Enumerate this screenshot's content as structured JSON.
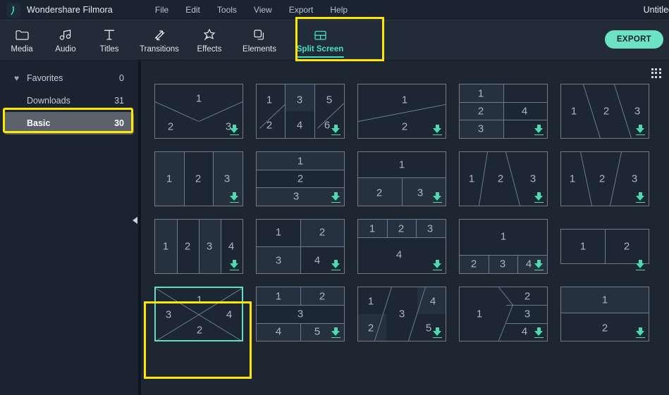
{
  "window": {
    "app_name": "Wondershare Filmora",
    "document_title": "Untitled",
    "logo_icon": "filmora-logo-icon"
  },
  "menubar": {
    "items": [
      {
        "label": "File"
      },
      {
        "label": "Edit"
      },
      {
        "label": "Tools"
      },
      {
        "label": "View"
      },
      {
        "label": "Export"
      },
      {
        "label": "Help"
      }
    ]
  },
  "toolbar": {
    "items": [
      {
        "label": "Media",
        "icon": "folder-icon",
        "active": false
      },
      {
        "label": "Audio",
        "icon": "music-note-icon",
        "active": false
      },
      {
        "label": "Titles",
        "icon": "text-t-icon",
        "active": false
      },
      {
        "label": "Transitions",
        "icon": "diagonal-arrows-icon",
        "active": false
      },
      {
        "label": "Effects",
        "icon": "sparkle-star-icon",
        "active": false
      },
      {
        "label": "Elements",
        "icon": "overlapping-squares-icon",
        "active": false
      },
      {
        "label": "Split Screen",
        "icon": "split-screen-icon",
        "active": true
      }
    ],
    "export_label": "EXPORT"
  },
  "sidebar": {
    "items": [
      {
        "label": "Favorites",
        "count": "0",
        "icon": "heart-icon",
        "selected": false,
        "indent": false
      },
      {
        "label": "Downloads",
        "count": "31",
        "icon": "",
        "selected": false,
        "indent": true
      },
      {
        "label": "Basic",
        "count": "30",
        "icon": "",
        "selected": true,
        "indent": true
      }
    ],
    "collapse_icon": "collapse-left-arrow-icon"
  },
  "content": {
    "grid_view_icon": "grid-dots-icon",
    "download_icon": "download-arrow-icon",
    "templates": [
      {
        "id": "t1",
        "layout": "v-split-3",
        "numbers": [
          "1",
          "2",
          "3"
        ],
        "downloadable": true,
        "selected": false
      },
      {
        "id": "t2",
        "layout": "six-diag",
        "numbers": [
          "1",
          "3",
          "5",
          "2",
          "4",
          "6"
        ],
        "downloadable": true,
        "selected": false
      },
      {
        "id": "t3",
        "layout": "diag-2",
        "numbers": [
          "1",
          "2"
        ],
        "downloadable": true,
        "selected": false
      },
      {
        "id": "t4",
        "layout": "stack3-right1",
        "numbers": [
          "1",
          "2",
          "3",
          "4"
        ],
        "downloadable": true,
        "selected": false
      },
      {
        "id": "t5",
        "layout": "slant-3-right",
        "numbers": [
          "1",
          "2",
          "3"
        ],
        "downloadable": true,
        "selected": false
      },
      {
        "id": "t6",
        "layout": "cols-3",
        "numbers": [
          "1",
          "2",
          "3"
        ],
        "downloadable": true,
        "selected": false
      },
      {
        "id": "t7",
        "layout": "rows-3",
        "numbers": [
          "1",
          "2",
          "3"
        ],
        "downloadable": true,
        "selected": false
      },
      {
        "id": "t8",
        "layout": "top1-bottom2",
        "numbers": [
          "1",
          "2",
          "3"
        ],
        "downloadable": true,
        "selected": false
      },
      {
        "id": "t9",
        "layout": "slant-3-a",
        "numbers": [
          "1",
          "2",
          "3"
        ],
        "downloadable": true,
        "selected": false
      },
      {
        "id": "t10",
        "layout": "slant-3-v",
        "numbers": [
          "1",
          "2",
          "3"
        ],
        "downloadable": true,
        "selected": false
      },
      {
        "id": "t11",
        "layout": "cols-4",
        "numbers": [
          "1",
          "2",
          "3",
          "4"
        ],
        "downloadable": true,
        "selected": false
      },
      {
        "id": "t12",
        "layout": "grid-2x2",
        "numbers": [
          "1",
          "2",
          "3",
          "4"
        ],
        "downloadable": true,
        "selected": false
      },
      {
        "id": "t13",
        "layout": "top3-bottom1",
        "numbers": [
          "1",
          "2",
          "3",
          "4"
        ],
        "downloadable": true,
        "selected": false
      },
      {
        "id": "t14",
        "layout": "top1-bottom3",
        "numbers": [
          "1",
          "2",
          "3",
          "4"
        ],
        "downloadable": true,
        "selected": false
      },
      {
        "id": "t15",
        "layout": "letterbox-2",
        "numbers": [
          "1",
          "2"
        ],
        "downloadable": true,
        "selected": false
      },
      {
        "id": "t16",
        "layout": "x-cross-4",
        "numbers": [
          "1",
          "3",
          "4",
          "2"
        ],
        "downloadable": false,
        "selected": true
      },
      {
        "id": "t17",
        "layout": "five-2-1-2",
        "numbers": [
          "1",
          "2",
          "3",
          "4",
          "5"
        ],
        "downloadable": true,
        "selected": false
      },
      {
        "id": "t18",
        "layout": "five-diag",
        "numbers": [
          "1",
          "2",
          "3",
          "4",
          "5"
        ],
        "downloadable": true,
        "selected": false
      },
      {
        "id": "t19",
        "layout": "chevron-4",
        "numbers": [
          "1",
          "2",
          "3",
          "4"
        ],
        "downloadable": true,
        "selected": false
      },
      {
        "id": "t20",
        "layout": "rows-2",
        "numbers": [
          "1",
          "2"
        ],
        "downloadable": true,
        "selected": false
      }
    ]
  },
  "colors": {
    "accent": "#45e0c0",
    "annotation": "#ffe800",
    "panel_bg": "#1e2631",
    "tile_bg": "#222c3a",
    "titlebar_bg": "#1b2330",
    "toolbar_bg": "#222b38",
    "selected_row_bg": "#5b626c"
  }
}
